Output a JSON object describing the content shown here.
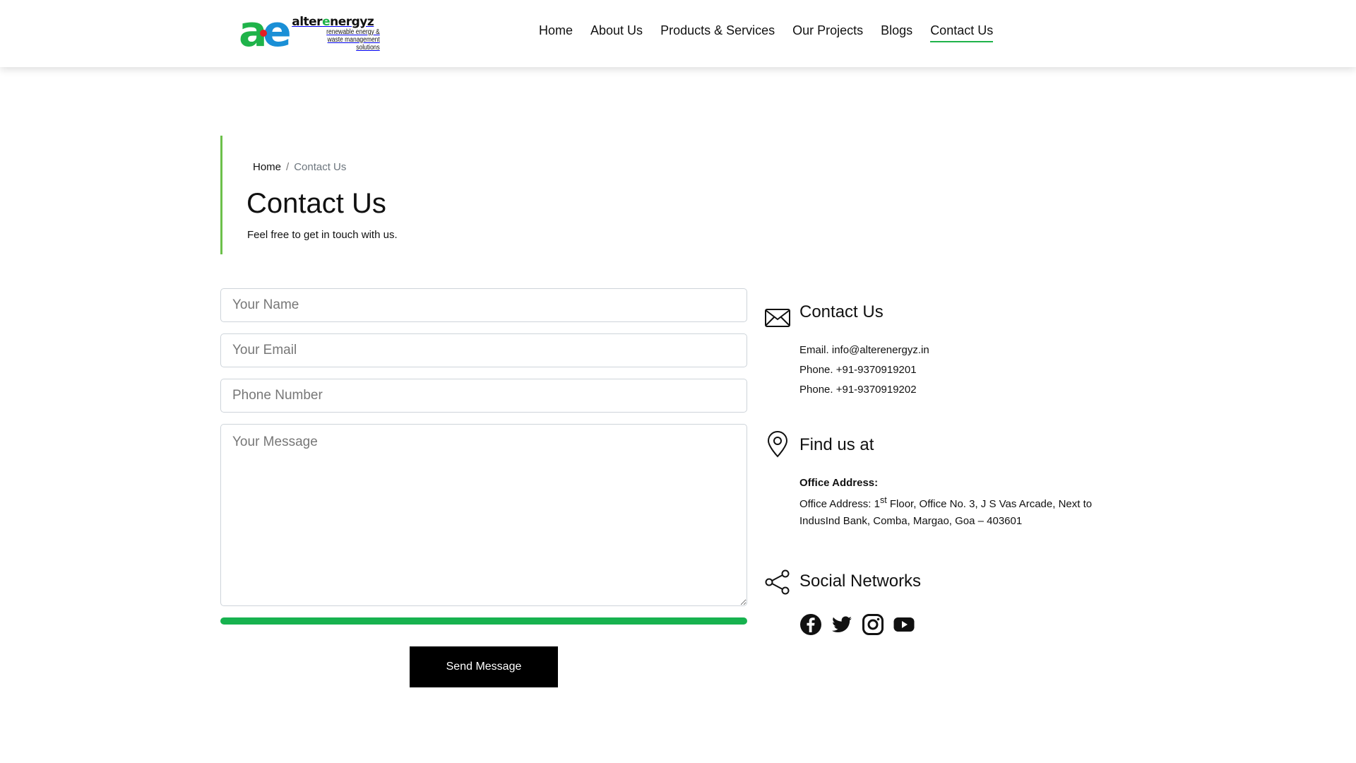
{
  "header": {
    "logo": {
      "brand_prefix": "alter",
      "brand_highlight": "e",
      "brand_suffix": "nergyz",
      "tagline_1": "renewable energy &",
      "tagline_2": "waste management solutions"
    },
    "nav": [
      {
        "label": "Home"
      },
      {
        "label": "About Us"
      },
      {
        "label": "Products & Services"
      },
      {
        "label": "Our Projects"
      },
      {
        "label": "Blogs"
      },
      {
        "label": "Contact Us",
        "active": true
      }
    ]
  },
  "breadcrumb": {
    "home": "Home",
    "separator": "/",
    "current": "Contact Us"
  },
  "page": {
    "title": "Contact Us",
    "subtitle": "Feel free to get in touch with us."
  },
  "form": {
    "name_placeholder": "Your Name",
    "email_placeholder": "Your Email",
    "phone_placeholder": "Phone Number",
    "message_placeholder": "Your Message",
    "progress_fraction": 1.0,
    "submit_label": "Send Message"
  },
  "contact": {
    "heading": "Contact Us",
    "email_label": "Email.",
    "email": "info@alterenergyz.in",
    "phone_label": "Phone.",
    "phone_1": "+91-9370919201",
    "phone_2": "+91-9370919202"
  },
  "location": {
    "heading": "Find us at",
    "office_label": "Office Address:",
    "address_prefix": "Office Address: 1",
    "address_sup": "st",
    "address_rest": " Floor, Office No. 3, J S Vas Arcade, Next to IndusInd Bank, Comba, Margao, Goa – 403601"
  },
  "social": {
    "heading": "Social Networks",
    "icons": [
      "facebook-icon",
      "twitter-icon",
      "instagram-icon",
      "youtube-icon"
    ]
  },
  "colors": {
    "accent_green": "#1fb34a",
    "logo_blue": "#1a8fd6",
    "progress": "#17b24f",
    "button": "#000000"
  }
}
